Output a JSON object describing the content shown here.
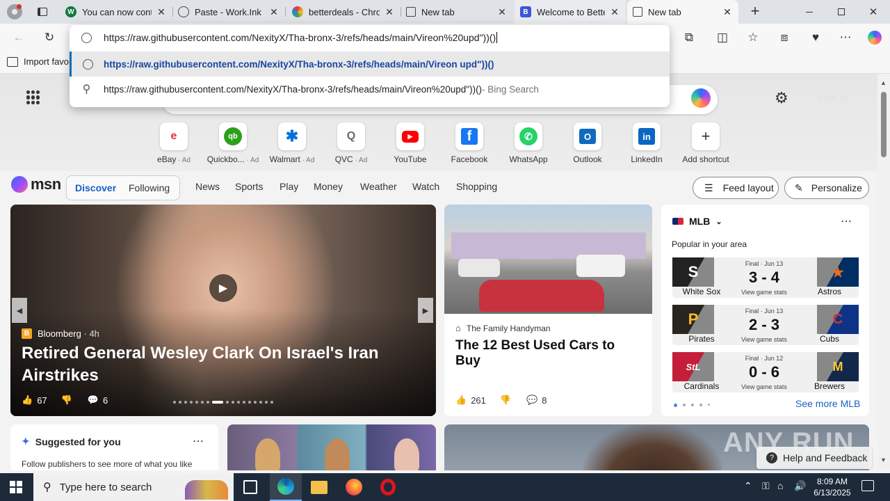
{
  "tabs": [
    {
      "title": "You can now continue",
      "favicon": "W",
      "color": "#0f7a3d"
    },
    {
      "title": "Paste - Work.Ink",
      "favicon": "globe",
      "color": "#555555"
    },
    {
      "title": "betterdeals - Chrome",
      "favicon": "rainbow",
      "color": "#e8713a"
    },
    {
      "title": "New tab",
      "favicon": "page",
      "color": "#444444"
    },
    {
      "title": "Welcome to BetterD",
      "favicon": "B",
      "color": "#3b57d6"
    },
    {
      "title": "New tab",
      "favicon": "page",
      "color": "#444444"
    }
  ],
  "address": {
    "value": "https://raw.githubusercontent.com/NexityX/Tha-bronx-3/refs/heads/main/Vireon%20upd\"))()"
  },
  "suggestions": [
    {
      "text": "https://raw.githubusercontent.com/NexityX/Tha-bronx-3/refs/heads/main/Vireon upd\"))()",
      "suffix": ""
    },
    {
      "text": "https://raw.githubusercontent.com/NexityX/Tha-bronx-3/refs/heads/main/Vireon%20upd\"))()",
      "suffix": " - Bing Search"
    }
  ],
  "favorites_bar": {
    "import_label": "Import favor"
  },
  "header": {
    "sign_in": "Sign in"
  },
  "shortcuts": [
    {
      "label": "eBay",
      "ad": " · Ad",
      "glyph": "e",
      "color": "#e53238"
    },
    {
      "label": "Quickbo...",
      "ad": " · Ad",
      "glyph": "qb",
      "color": "#2ca01c"
    },
    {
      "label": "Walmart",
      "ad": " · Ad",
      "glyph": "✱",
      "color": "#0071dc"
    },
    {
      "label": "QVC",
      "ad": " · Ad",
      "glyph": "Q",
      "color": "#666666"
    },
    {
      "label": "YouTube",
      "ad": "",
      "glyph": "▶",
      "color": "#ff0000"
    },
    {
      "label": "Facebook",
      "ad": "",
      "glyph": "f",
      "color": "#1877f2"
    },
    {
      "label": "WhatsApp",
      "ad": "",
      "glyph": "✆",
      "color": "#25d366"
    },
    {
      "label": "Outlook",
      "ad": "",
      "glyph": "O",
      "color": "#0f6cbd"
    },
    {
      "label": "LinkedIn",
      "ad": "",
      "glyph": "in",
      "color": "#0a66c2"
    },
    {
      "label": "Add shortcut",
      "ad": "",
      "glyph": "+",
      "color": "#333333"
    }
  ],
  "msn": {
    "logo": "msn",
    "primary_tabs": [
      "Discover",
      "Following"
    ],
    "nav": [
      "News",
      "Sports",
      "Play",
      "Money",
      "Weather",
      "Watch",
      "Shopping"
    ],
    "feed_layout": "Feed layout",
    "personalize": "Personalize"
  },
  "main_story": {
    "source": "Bloomberg",
    "age": "· 4h",
    "title": "Retired General Wesley Clark On Israel's Iran Airstrikes",
    "likes": "67",
    "comments": "6"
  },
  "second_story": {
    "source": "The Family Handyman",
    "title": "The 12 Best Used Cars to Buy",
    "likes": "261",
    "comments": "8"
  },
  "mlb": {
    "title": "MLB",
    "subtitle": "Popular in your area",
    "see_more": "See more MLB",
    "games": [
      {
        "status": "Final · Jun 13",
        "score": "3 - 4",
        "stats": "View game stats",
        "home": "White Sox",
        "away": "Astros",
        "home_color": "#222222",
        "away_color": "#002d62"
      },
      {
        "status": "Final · Jun 13",
        "score": "2 - 3",
        "stats": "View game stats",
        "home": "Pirates",
        "away": "Cubs",
        "home_color": "#27251f",
        "away_color": "#0e3386"
      },
      {
        "status": "Final · Jun 12",
        "score": "0 - 6",
        "stats": "View game stats",
        "home": "Cardinals",
        "away": "Brewers",
        "home_color": "#c41e3a",
        "away_color": "#12284b"
      }
    ]
  },
  "suggested": {
    "title": "Suggested for you",
    "subtitle": "Follow publishers to see more of what you like"
  },
  "help_feedback": "Help and Feedback",
  "watermark": "ANY RUN",
  "taskbar": {
    "search_placeholder": "Type here to search",
    "time": "8:09 AM",
    "date": "6/13/2025"
  }
}
